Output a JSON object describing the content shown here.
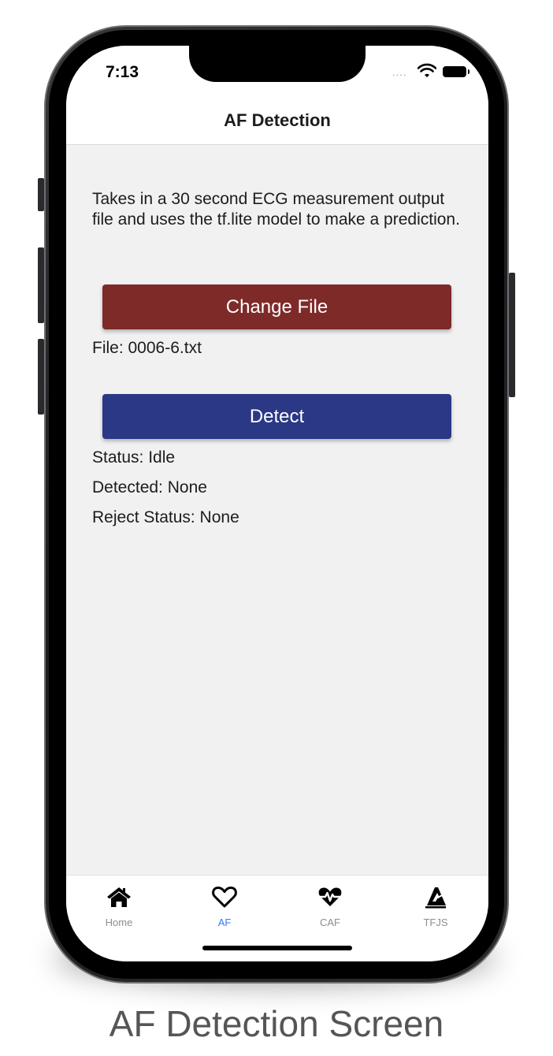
{
  "status_bar": {
    "time": "7:13",
    "signal_dots": "....",
    "wifi_icon": "wifi-icon",
    "battery_icon": "battery-icon"
  },
  "nav": {
    "title": "AF Detection"
  },
  "main": {
    "description": "Takes in a 30 second ECG measurement output file and uses the tf.lite model to make a prediction.",
    "change_file_label": "Change File",
    "file_text": "File: 0006-6.txt",
    "detect_label": "Detect",
    "status_text": "Status: Idle",
    "detected_text": "Detected: None",
    "reject_text": "Reject Status: None"
  },
  "tabs": [
    {
      "label": "Home",
      "icon": "home-icon",
      "active": false
    },
    {
      "label": "AF",
      "icon": "heart-outline-icon",
      "active": true
    },
    {
      "label": "CAF",
      "icon": "heartbeat-icon",
      "active": false
    },
    {
      "label": "TFJS",
      "icon": "tfjs-icon",
      "active": false
    }
  ],
  "colors": {
    "change_button": "#7e2a29",
    "detect_button": "#2b3886",
    "active_tab": "#2f7cf6",
    "inactive_tab": "#8e8e93"
  },
  "caption": "AF Detection Screen"
}
